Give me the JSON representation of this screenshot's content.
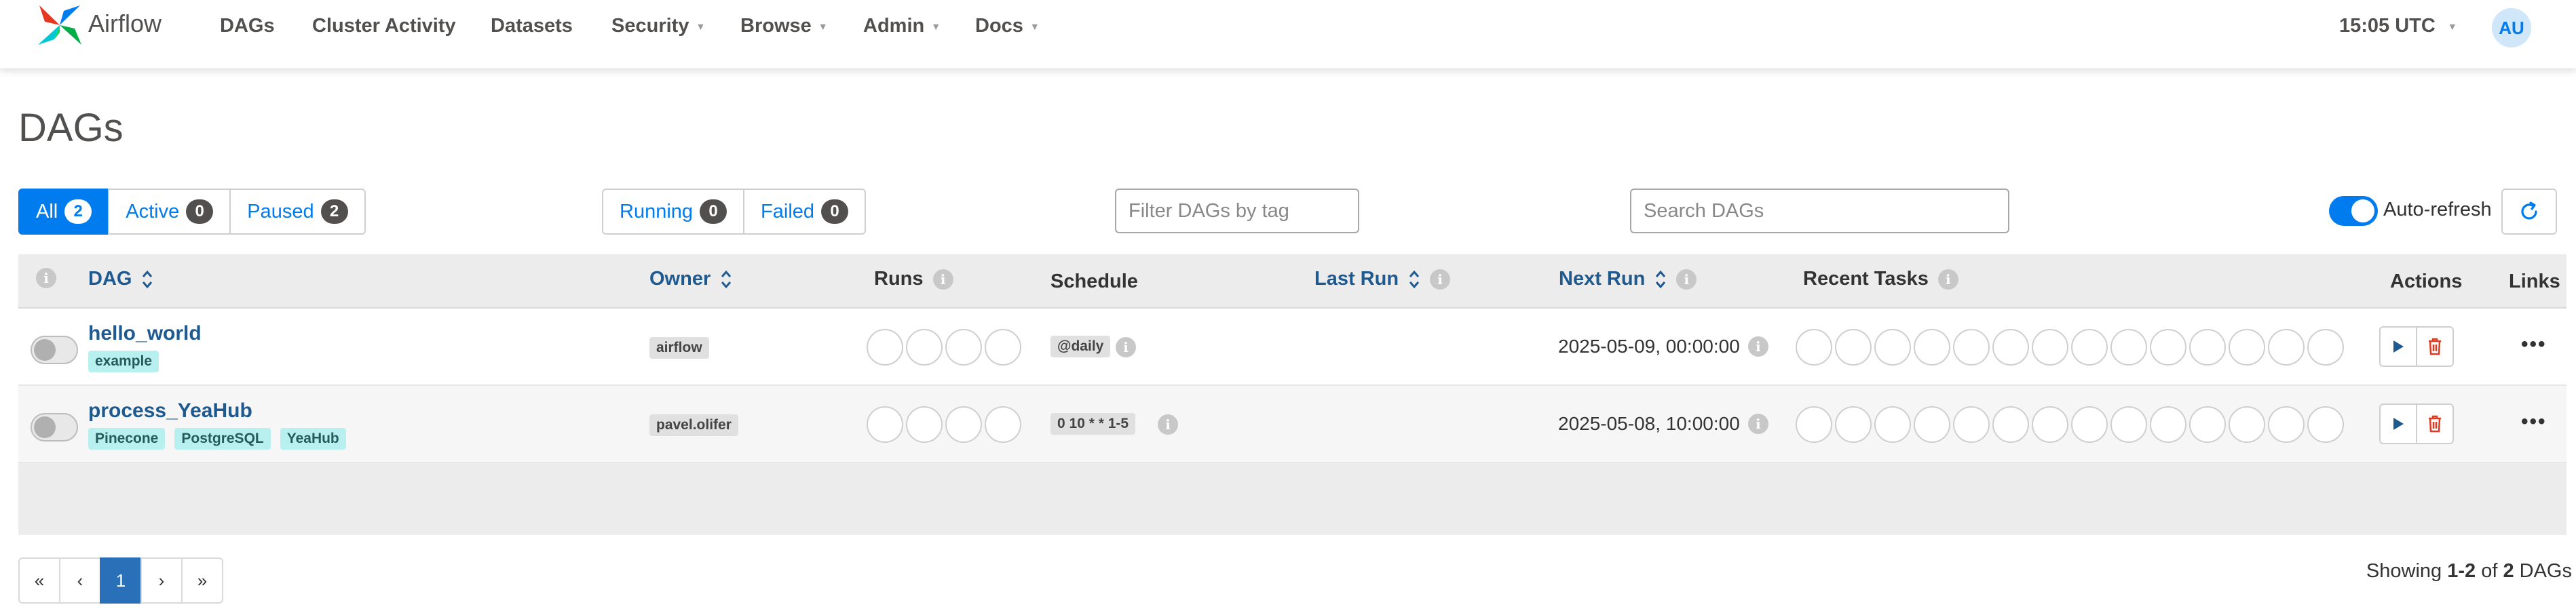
{
  "navbar": {
    "brand": "Airflow",
    "items": [
      {
        "label": "DAGs",
        "dropdown": false
      },
      {
        "label": "Cluster Activity",
        "dropdown": false
      },
      {
        "label": "Datasets",
        "dropdown": false
      },
      {
        "label": "Security",
        "dropdown": true
      },
      {
        "label": "Browse",
        "dropdown": true
      },
      {
        "label": "Admin",
        "dropdown": true
      },
      {
        "label": "Docs",
        "dropdown": true
      }
    ],
    "time": "15:05 UTC",
    "user_initials": "AU"
  },
  "page": {
    "title": "DAGs"
  },
  "filters": {
    "status": [
      {
        "label": "All",
        "count": "2"
      },
      {
        "label": "Active",
        "count": "0"
      },
      {
        "label": "Paused",
        "count": "2"
      }
    ],
    "runs": [
      {
        "label": "Running",
        "count": "0"
      },
      {
        "label": "Failed",
        "count": "0"
      }
    ],
    "tag_placeholder": "Filter DAGs by tag",
    "search_placeholder": "Search DAGs",
    "auto_refresh_label": "Auto-refresh"
  },
  "table": {
    "headers": {
      "dag": "DAG",
      "owner": "Owner",
      "runs": "Runs",
      "schedule": "Schedule",
      "last_run": "Last Run",
      "next_run": "Next Run",
      "recent_tasks": "Recent Tasks",
      "actions": "Actions",
      "links": "Links"
    },
    "rows": [
      {
        "name": "hello_world",
        "tags": [
          "example"
        ],
        "owner": "airflow",
        "schedule": "@daily",
        "last_run": "",
        "next_run": "2025-05-09, 00:00:00",
        "paused": true
      },
      {
        "name": "process_YeaHub",
        "tags": [
          "Pinecone",
          "PostgreSQL",
          "YeaHub"
        ],
        "owner": "pavel.olifer",
        "schedule": "0 10 * * 1-5",
        "last_run": "",
        "next_run": "2025-05-08, 10:00:00",
        "paused": true
      }
    ]
  },
  "pagination": {
    "first": "«",
    "prev": "‹",
    "current": "1",
    "next": "›",
    "last": "»"
  },
  "footer": {
    "showing_prefix": "Showing ",
    "showing_range": "1-2",
    "showing_of": " of ",
    "showing_total": "2",
    "showing_suffix": " DAGs"
  },
  "colors": {
    "primary": "#017cee",
    "link": "#1e5a90",
    "tag_bg": "#b8f0f0",
    "delete_red": "#e43921"
  },
  "icons": [
    "airflow-logo-icon",
    "caret-down-icon",
    "sort-icon",
    "info-icon",
    "play-icon",
    "trash-icon",
    "more-icon",
    "refresh-icon"
  ]
}
